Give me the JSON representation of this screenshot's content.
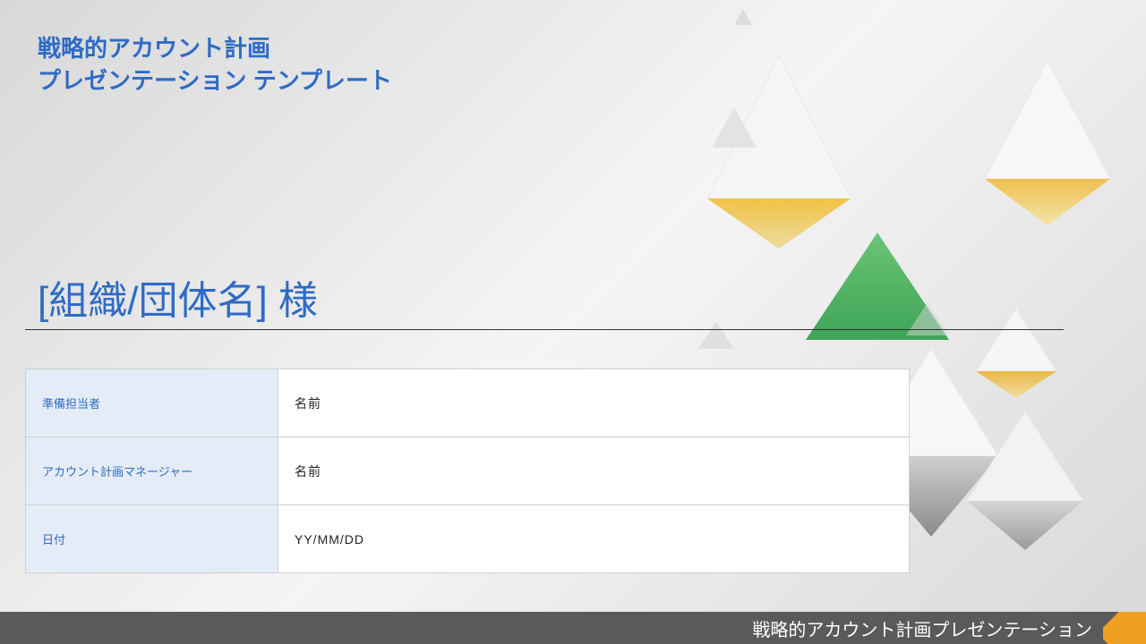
{
  "header": {
    "line1": "戦略的アカウント計画",
    "line2": "プレゼンテーション テンプレート"
  },
  "org_title": "[組織/団体名] 様",
  "table": {
    "rows": [
      {
        "label": "準備担当者",
        "value": "名前"
      },
      {
        "label": "アカウント計画マネージャー",
        "value": "名前"
      },
      {
        "label": "日付",
        "value": "YY/MM/DD"
      }
    ]
  },
  "footer": "戦略的アカウント計画プレゼンテーション"
}
